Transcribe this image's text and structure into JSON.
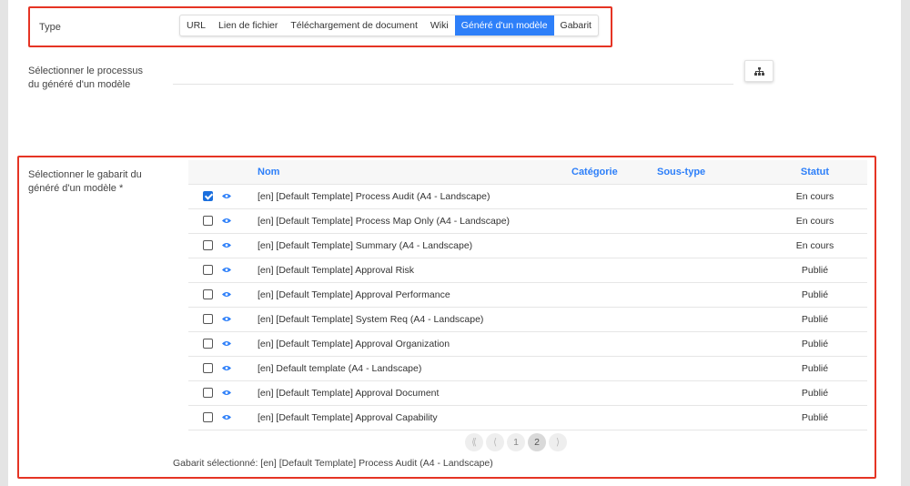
{
  "type_field": {
    "label": "Type",
    "options": [
      {
        "label": "URL",
        "active": false
      },
      {
        "label": "Lien de fichier",
        "active": false
      },
      {
        "label": "Téléchargement de document",
        "active": false
      },
      {
        "label": "Wiki",
        "active": false
      },
      {
        "label": "Généré d'un modèle",
        "active": true
      },
      {
        "label": "Gabarit",
        "active": false
      }
    ]
  },
  "process_field": {
    "label_line1": "Sélectionner le processus",
    "label_line2": "du généré d'un modèle",
    "value": "",
    "button_icon": "sitemap-icon"
  },
  "template_field": {
    "label_line1": "Sélectionner le gabarit du",
    "label_line2": "généré d'un modèle *",
    "columns": {
      "nom": "Nom",
      "categorie": "Catégorie",
      "sous_type": "Sous-type",
      "statut": "Statut"
    },
    "rows": [
      {
        "checked": true,
        "nom": "[en] [Default Template] Process Audit (A4 - Landscape)",
        "categorie": "",
        "sous_type": "",
        "statut": "En cours"
      },
      {
        "checked": false,
        "nom": "[en] [Default Template] Process Map Only (A4 - Landscape)",
        "categorie": "",
        "sous_type": "",
        "statut": "En cours"
      },
      {
        "checked": false,
        "nom": "[en] [Default Template] Summary (A4 - Landscape)",
        "categorie": "",
        "sous_type": "",
        "statut": "En cours"
      },
      {
        "checked": false,
        "nom": "[en] [Default Template] Approval Risk",
        "categorie": "",
        "sous_type": "",
        "statut": "Publié"
      },
      {
        "checked": false,
        "nom": "[en] [Default Template] Approval Performance",
        "categorie": "",
        "sous_type": "",
        "statut": "Publié"
      },
      {
        "checked": false,
        "nom": "[en] [Default Template] System Req (A4 - Landscape)",
        "categorie": "",
        "sous_type": "",
        "statut": "Publié"
      },
      {
        "checked": false,
        "nom": "[en] [Default Template] Approval Organization",
        "categorie": "",
        "sous_type": "",
        "statut": "Publié"
      },
      {
        "checked": false,
        "nom": "[en] Default template (A4 - Landscape)",
        "categorie": "",
        "sous_type": "",
        "statut": "Publié"
      },
      {
        "checked": false,
        "nom": "[en] [Default Template] Approval Document",
        "categorie": "",
        "sous_type": "",
        "statut": "Publié"
      },
      {
        "checked": false,
        "nom": "[en] [Default Template] Approval Capability",
        "categorie": "",
        "sous_type": "",
        "statut": "Publié"
      }
    ],
    "pagination": {
      "first": "⟪",
      "prev": "⟨",
      "pages": [
        "1",
        "2"
      ],
      "current": "2",
      "next": "⟩"
    },
    "selected_text": "Gabarit sélectionné: [en] [Default Template] Process Audit (A4 - Landscape)"
  },
  "colors": {
    "accent": "#2d7ff9",
    "highlight_border": "#e53424"
  }
}
